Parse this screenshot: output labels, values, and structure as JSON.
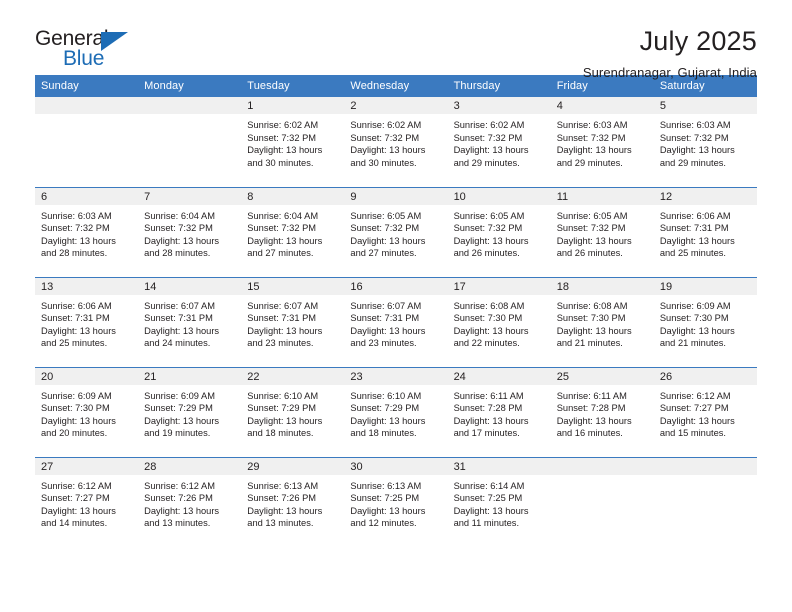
{
  "logo": {
    "word_top": "General",
    "word_bottom": "Blue",
    "triangle_icon": "triangle-icon",
    "brand_color": "#1d6cb5"
  },
  "header": {
    "title": "July 2025",
    "subtitle": "Surendranagar, Gujarat, India"
  },
  "theme": {
    "header_blue": "#3b7ac0",
    "daynum_band": "#f0f0f0",
    "text": "#231f20"
  },
  "weekday_headers": [
    "Sunday",
    "Monday",
    "Tuesday",
    "Wednesday",
    "Thursday",
    "Friday",
    "Saturday"
  ],
  "labels": {
    "sunrise_prefix": "Sunrise:",
    "sunset_prefix": "Sunset:",
    "daylight_prefix": "Daylight:"
  },
  "weeks": [
    [
      {
        "day": "",
        "blank": true,
        "sunrise": "",
        "sunset": "",
        "daylight_line1": "",
        "daylight_line2": ""
      },
      {
        "day": "",
        "blank": true,
        "sunrise": "",
        "sunset": "",
        "daylight_line1": "",
        "daylight_line2": ""
      },
      {
        "day": "1",
        "blank": false,
        "sunrise": "Sunrise: 6:02 AM",
        "sunset": "Sunset: 7:32 PM",
        "daylight_line1": "Daylight: 13 hours",
        "daylight_line2": "and 30 minutes."
      },
      {
        "day": "2",
        "blank": false,
        "sunrise": "Sunrise: 6:02 AM",
        "sunset": "Sunset: 7:32 PM",
        "daylight_line1": "Daylight: 13 hours",
        "daylight_line2": "and 30 minutes."
      },
      {
        "day": "3",
        "blank": false,
        "sunrise": "Sunrise: 6:02 AM",
        "sunset": "Sunset: 7:32 PM",
        "daylight_line1": "Daylight: 13 hours",
        "daylight_line2": "and 29 minutes."
      },
      {
        "day": "4",
        "blank": false,
        "sunrise": "Sunrise: 6:03 AM",
        "sunset": "Sunset: 7:32 PM",
        "daylight_line1": "Daylight: 13 hours",
        "daylight_line2": "and 29 minutes."
      },
      {
        "day": "5",
        "blank": false,
        "sunrise": "Sunrise: 6:03 AM",
        "sunset": "Sunset: 7:32 PM",
        "daylight_line1": "Daylight: 13 hours",
        "daylight_line2": "and 29 minutes."
      }
    ],
    [
      {
        "day": "6",
        "blank": false,
        "sunrise": "Sunrise: 6:03 AM",
        "sunset": "Sunset: 7:32 PM",
        "daylight_line1": "Daylight: 13 hours",
        "daylight_line2": "and 28 minutes."
      },
      {
        "day": "7",
        "blank": false,
        "sunrise": "Sunrise: 6:04 AM",
        "sunset": "Sunset: 7:32 PM",
        "daylight_line1": "Daylight: 13 hours",
        "daylight_line2": "and 28 minutes."
      },
      {
        "day": "8",
        "blank": false,
        "sunrise": "Sunrise: 6:04 AM",
        "sunset": "Sunset: 7:32 PM",
        "daylight_line1": "Daylight: 13 hours",
        "daylight_line2": "and 27 minutes."
      },
      {
        "day": "9",
        "blank": false,
        "sunrise": "Sunrise: 6:05 AM",
        "sunset": "Sunset: 7:32 PM",
        "daylight_line1": "Daylight: 13 hours",
        "daylight_line2": "and 27 minutes."
      },
      {
        "day": "10",
        "blank": false,
        "sunrise": "Sunrise: 6:05 AM",
        "sunset": "Sunset: 7:32 PM",
        "daylight_line1": "Daylight: 13 hours",
        "daylight_line2": "and 26 minutes."
      },
      {
        "day": "11",
        "blank": false,
        "sunrise": "Sunrise: 6:05 AM",
        "sunset": "Sunset: 7:32 PM",
        "daylight_line1": "Daylight: 13 hours",
        "daylight_line2": "and 26 minutes."
      },
      {
        "day": "12",
        "blank": false,
        "sunrise": "Sunrise: 6:06 AM",
        "sunset": "Sunset: 7:31 PM",
        "daylight_line1": "Daylight: 13 hours",
        "daylight_line2": "and 25 minutes."
      }
    ],
    [
      {
        "day": "13",
        "blank": false,
        "sunrise": "Sunrise: 6:06 AM",
        "sunset": "Sunset: 7:31 PM",
        "daylight_line1": "Daylight: 13 hours",
        "daylight_line2": "and 25 minutes."
      },
      {
        "day": "14",
        "blank": false,
        "sunrise": "Sunrise: 6:07 AM",
        "sunset": "Sunset: 7:31 PM",
        "daylight_line1": "Daylight: 13 hours",
        "daylight_line2": "and 24 minutes."
      },
      {
        "day": "15",
        "blank": false,
        "sunrise": "Sunrise: 6:07 AM",
        "sunset": "Sunset: 7:31 PM",
        "daylight_line1": "Daylight: 13 hours",
        "daylight_line2": "and 23 minutes."
      },
      {
        "day": "16",
        "blank": false,
        "sunrise": "Sunrise: 6:07 AM",
        "sunset": "Sunset: 7:31 PM",
        "daylight_line1": "Daylight: 13 hours",
        "daylight_line2": "and 23 minutes."
      },
      {
        "day": "17",
        "blank": false,
        "sunrise": "Sunrise: 6:08 AM",
        "sunset": "Sunset: 7:30 PM",
        "daylight_line1": "Daylight: 13 hours",
        "daylight_line2": "and 22 minutes."
      },
      {
        "day": "18",
        "blank": false,
        "sunrise": "Sunrise: 6:08 AM",
        "sunset": "Sunset: 7:30 PM",
        "daylight_line1": "Daylight: 13 hours",
        "daylight_line2": "and 21 minutes."
      },
      {
        "day": "19",
        "blank": false,
        "sunrise": "Sunrise: 6:09 AM",
        "sunset": "Sunset: 7:30 PM",
        "daylight_line1": "Daylight: 13 hours",
        "daylight_line2": "and 21 minutes."
      }
    ],
    [
      {
        "day": "20",
        "blank": false,
        "sunrise": "Sunrise: 6:09 AM",
        "sunset": "Sunset: 7:30 PM",
        "daylight_line1": "Daylight: 13 hours",
        "daylight_line2": "and 20 minutes."
      },
      {
        "day": "21",
        "blank": false,
        "sunrise": "Sunrise: 6:09 AM",
        "sunset": "Sunset: 7:29 PM",
        "daylight_line1": "Daylight: 13 hours",
        "daylight_line2": "and 19 minutes."
      },
      {
        "day": "22",
        "blank": false,
        "sunrise": "Sunrise: 6:10 AM",
        "sunset": "Sunset: 7:29 PM",
        "daylight_line1": "Daylight: 13 hours",
        "daylight_line2": "and 18 minutes."
      },
      {
        "day": "23",
        "blank": false,
        "sunrise": "Sunrise: 6:10 AM",
        "sunset": "Sunset: 7:29 PM",
        "daylight_line1": "Daylight: 13 hours",
        "daylight_line2": "and 18 minutes."
      },
      {
        "day": "24",
        "blank": false,
        "sunrise": "Sunrise: 6:11 AM",
        "sunset": "Sunset: 7:28 PM",
        "daylight_line1": "Daylight: 13 hours",
        "daylight_line2": "and 17 minutes."
      },
      {
        "day": "25",
        "blank": false,
        "sunrise": "Sunrise: 6:11 AM",
        "sunset": "Sunset: 7:28 PM",
        "daylight_line1": "Daylight: 13 hours",
        "daylight_line2": "and 16 minutes."
      },
      {
        "day": "26",
        "blank": false,
        "sunrise": "Sunrise: 6:12 AM",
        "sunset": "Sunset: 7:27 PM",
        "daylight_line1": "Daylight: 13 hours",
        "daylight_line2": "and 15 minutes."
      }
    ],
    [
      {
        "day": "27",
        "blank": false,
        "sunrise": "Sunrise: 6:12 AM",
        "sunset": "Sunset: 7:27 PM",
        "daylight_line1": "Daylight: 13 hours",
        "daylight_line2": "and 14 minutes."
      },
      {
        "day": "28",
        "blank": false,
        "sunrise": "Sunrise: 6:12 AM",
        "sunset": "Sunset: 7:26 PM",
        "daylight_line1": "Daylight: 13 hours",
        "daylight_line2": "and 13 minutes."
      },
      {
        "day": "29",
        "blank": false,
        "sunrise": "Sunrise: 6:13 AM",
        "sunset": "Sunset: 7:26 PM",
        "daylight_line1": "Daylight: 13 hours",
        "daylight_line2": "and 13 minutes."
      },
      {
        "day": "30",
        "blank": false,
        "sunrise": "Sunrise: 6:13 AM",
        "sunset": "Sunset: 7:25 PM",
        "daylight_line1": "Daylight: 13 hours",
        "daylight_line2": "and 12 minutes."
      },
      {
        "day": "31",
        "blank": false,
        "sunrise": "Sunrise: 6:14 AM",
        "sunset": "Sunset: 7:25 PM",
        "daylight_line1": "Daylight: 13 hours",
        "daylight_line2": "and 11 minutes."
      },
      {
        "day": "",
        "blank": true,
        "sunrise": "",
        "sunset": "",
        "daylight_line1": "",
        "daylight_line2": ""
      },
      {
        "day": "",
        "blank": true,
        "sunrise": "",
        "sunset": "",
        "daylight_line1": "",
        "daylight_line2": ""
      }
    ]
  ]
}
